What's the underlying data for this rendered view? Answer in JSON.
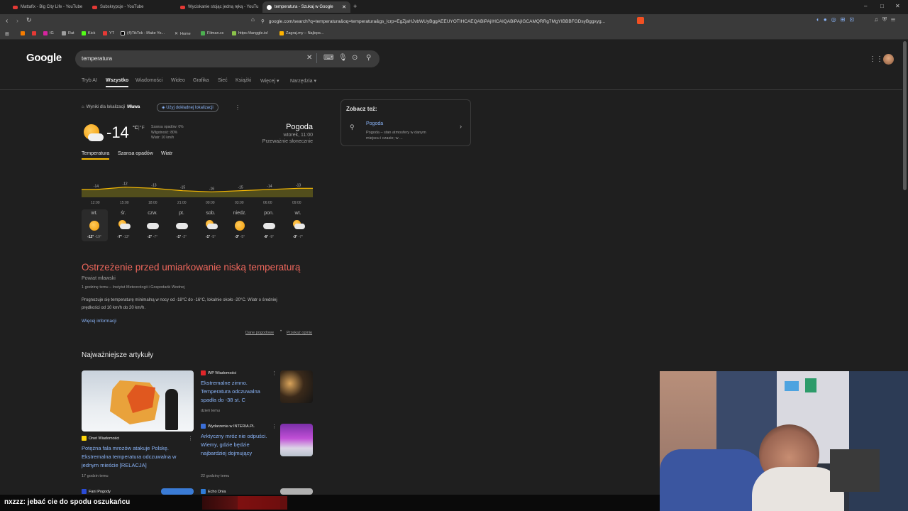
{
  "tabs": [
    {
      "label": "Mattafix - Big City Life - YouTube"
    },
    {
      "label": "Subskrypcje - YouTube"
    },
    {
      "label": "Wyciskanie stojąc jedną ręką - YouTu"
    },
    {
      "label": "temperatura - Szukaj w Google"
    }
  ],
  "url": "google.com/search?q=temperatura&oq=temperatura&gs_lcrp=EgZjaHJvbWUyBggAEEUYOTIHCAEQABiPAjIHCAIQABiPAjIGCAMQRRg7MgYIBBBFGDsyBggxyg...",
  "bookmarks": [
    "IG",
    "Rat",
    "Kick",
    "YT",
    "(4)TikTok - Make Yo...",
    "Home",
    "Filman.cc",
    "https://tanggle.io/",
    "Zagraj.my – Najleps..."
  ],
  "google": {
    "logo": "Google",
    "query": "temperatura",
    "tabs": [
      "Tryb AI",
      "Wszystko",
      "Wiadomości",
      "Wideo",
      "Grafika",
      "Sieć",
      "Książki",
      "Więcej",
      "Narzędzia"
    ]
  },
  "weather": {
    "location_prefix": "Wyniki dla lokalizacji",
    "location": "Mława",
    "precise_location": "Użyj dokładnej lokalizacji",
    "temp": "-14",
    "unit_c": "°C",
    "unit_sep": "|",
    "unit_f": "°F",
    "precip": "Szansa opadów: 0%",
    "humidity": "Wilgotność: 80%",
    "wind": "Wiatr: 10 km/h",
    "title": "Pogoda",
    "time": "wtorek, 11:00",
    "condition": "Przeważnie słonecznie",
    "tabs": [
      "Temperatura",
      "Szansa opadów",
      "Wiatr"
    ],
    "hourly_values": [
      "-14",
      "-12",
      "-13",
      "-15",
      "-16",
      "-15",
      "-14",
      "-13"
    ],
    "hours": [
      "12:00",
      "15:00",
      "18:00",
      "21:00",
      "00:00",
      "03:00",
      "06:00",
      "09:00"
    ],
    "days": [
      {
        "name": "wt.",
        "hi": "-12°",
        "lo": "-19°",
        "icon": "sun-icon"
      },
      {
        "name": "śr.",
        "hi": "-7°",
        "lo": "-13°",
        "icon": "partly-cloudy-icon"
      },
      {
        "name": "czw.",
        "hi": "-2°",
        "lo": "-7°",
        "icon": "cloud-icon"
      },
      {
        "name": "pt.",
        "hi": "-1°",
        "lo": "-2°",
        "icon": "cloud-icon"
      },
      {
        "name": "sob.",
        "hi": "-1°",
        "lo": "-5°",
        "icon": "partly-cloudy-icon"
      },
      {
        "name": "niedz.",
        "hi": "-3°",
        "lo": "-5°",
        "icon": "sun-icon"
      },
      {
        "name": "pon.",
        "hi": "-6°",
        "lo": "-9°",
        "icon": "cloud-icon"
      },
      {
        "name": "wt.",
        "hi": "-3°",
        "lo": "-7°",
        "icon": "partly-cloudy-icon"
      }
    ]
  },
  "warning": {
    "title": "Ostrzeżenie przed umiarkowanie niską temperaturą",
    "area": "Powiat mławski",
    "source": "1 godzinę temu – Instytut Meteorologii i Gospodarki Wodnej",
    "body1": "Prognozuje się temperaturę minimalną w nocy od -18°C do -16°C, lokalnie około -20°C. Wiatr o średniej",
    "body2": "prędkości od 10 km/h do 20 km/h.",
    "more": "Więcej informacji",
    "data_link": "Dane pogodowe",
    "feedback_link": "Przekaż opinię"
  },
  "articles": {
    "heading": "Najważniejsze artykuły",
    "items": [
      {
        "source": "Onet Wiadomości",
        "title1": "Potężna fala mrozów atakuje Polskę.",
        "title2": "Ekstremalna temperatura odczuwalna w",
        "title3": "jednym mieście [RELACJA]",
        "time": "17 godzin temu"
      },
      {
        "source": "WP Wiadomości",
        "title1": "Ekstremalne zimno.",
        "title2": "Temperatura odczuwalna",
        "title3": "spadła do -38 st. C",
        "time": "dzień temu"
      },
      {
        "source": "Wydarzenia w INTERIA.PL",
        "title1": "Arktyczny mróz nie odpuści.",
        "title2": "Wiemy, gdzie będzie",
        "title3": "najbardziej dojmujący",
        "time": "22 godziny temu"
      },
      {
        "source": "Fani Pogody"
      },
      {
        "source": "Echo Dnia"
      }
    ]
  },
  "see_also": {
    "heading": "Zobacz też:",
    "title": "Pogoda",
    "desc1": "Pogoda – stan atmosfery w danym",
    "desc2": "miejscu i czasie; w ..."
  },
  "chat": {
    "user": "nxzzz",
    "message": ": jebać cie do spodu oszukańcu"
  }
}
